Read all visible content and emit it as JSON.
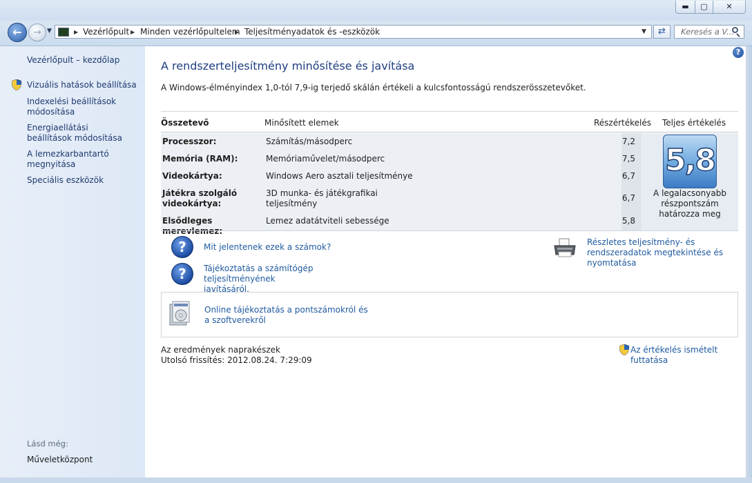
{
  "window": {
    "min_glyph": "▬",
    "max_glyph": "▢",
    "close_glyph": "✕"
  },
  "address": {
    "crumbs": [
      "Vezérlőpult",
      "Minden vezérlőpultelem",
      "Teljesítményadatok és -eszközök"
    ],
    "search_placeholder": "Keresés a V..."
  },
  "sidebar": {
    "home": "Vezérlőpult – kezdőlap",
    "items": [
      {
        "label": "Vizuális hatások beállítása",
        "shield": true
      },
      {
        "label": "Indexelési beállítások módosítása"
      },
      {
        "label": "Energiaellátási beállítások módosítása"
      },
      {
        "label": "A lemezkarbantartó megnyitása"
      },
      {
        "label": "Speciális eszközök"
      }
    ],
    "see_also": "Lásd még:",
    "action_center": "Műveletközpont"
  },
  "main": {
    "title": "A rendszerteljesítmény minősítése és javítása",
    "description": "A Windows-élményindex 1,0-tól 7,9-ig terjedő skálán értékeli a kulcsfontosságú rendszerösszetevőket.",
    "table": {
      "headers": {
        "component": "Összetevő",
        "rated": "Minősített elemek",
        "subscore": "Részértékelés",
        "base": "Teljes értékelés"
      },
      "rows": [
        {
          "component": "Processzor:",
          "item": "Számítás/másodperc",
          "score": "7,2"
        },
        {
          "component": "Memória (RAM):",
          "item": "Memóriaművelet/másodperc",
          "score": "7,5"
        },
        {
          "component": "Videokártya:",
          "item": "Windows Aero asztali teljesítménye",
          "score": "6,7"
        },
        {
          "component": "Játékra szolgáló videokártya:",
          "item": "3D munka- és játékgrafikai teljesítmény",
          "score": "6,7"
        },
        {
          "component": "Elsődleges merevlemez:",
          "item": "Lemez adatátviteli sebessége",
          "score": "5,8"
        }
      ],
      "base_score": "5,8",
      "base_note": "A legalacsonyabb részpontszám határozza meg"
    },
    "links": {
      "what_numbers": "Mit jelentenek ezek a számok?",
      "improve": "Tájékoztatás a számítógép teljesítményének javításáról.",
      "details_print": "Részletes teljesítmény- és rendszeradatok megtekintése és nyomtatása",
      "online": "Online tájékoztatás a pontszámokról és a szoftverekről",
      "rerun": "Az értékelés ismételt futtatása"
    },
    "status": {
      "current": "Az eredmények naprakészek",
      "last_update": "Utolsó frissítés: 2012.08.24. 7:29:09"
    }
  }
}
